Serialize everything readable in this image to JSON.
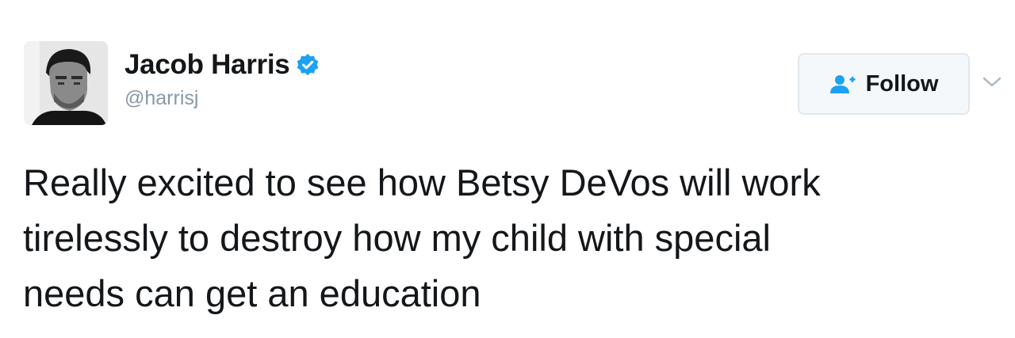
{
  "author": {
    "name": "Jacob Harris",
    "handle": "@harrisj",
    "verified": true
  },
  "follow": {
    "label": "Follow"
  },
  "tweet": {
    "lines": [
      "Really excited to see how Betsy DeVos will work",
      "tirelessly to destroy how my child with special",
      "needs can get an education"
    ]
  },
  "icons": {
    "avatar": "profile-photo",
    "verified": "verified-badge-icon",
    "follow": "add-user-icon",
    "more": "chevron-down-icon"
  },
  "colors": {
    "brand": "#1da1f2",
    "text": "#14171a",
    "muted": "#8899a6",
    "button_border": "#e1e8ed",
    "button_bg": "#f5f8fa"
  }
}
